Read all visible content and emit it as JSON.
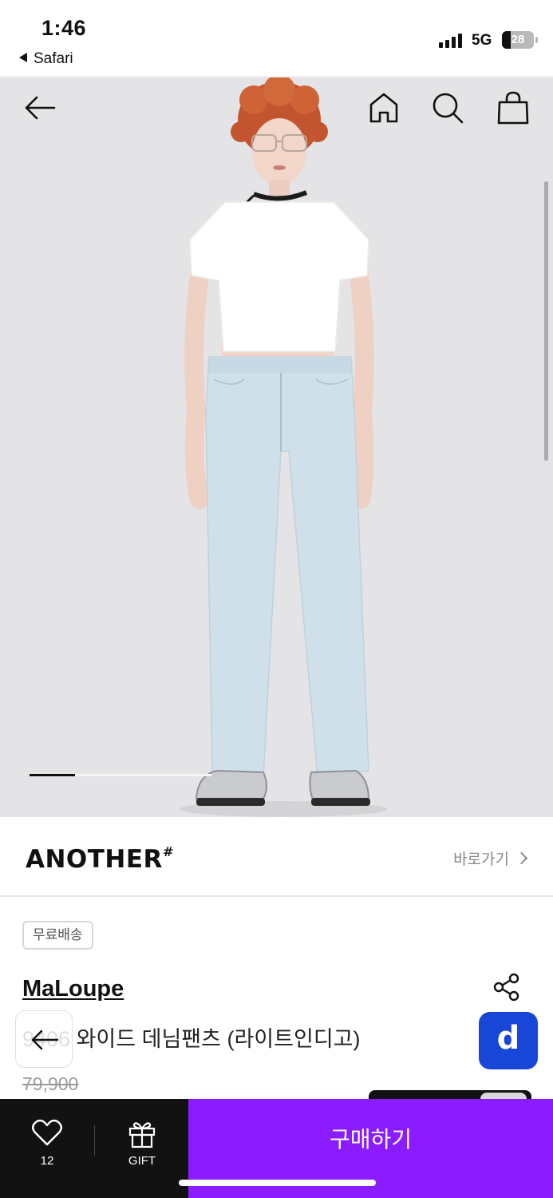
{
  "status_bar": {
    "time": "1:46",
    "back_app": "Safari",
    "network": "5G",
    "battery": "28",
    "battery_level_percent": 28
  },
  "gallery": {
    "current_index_fraction": 0.25,
    "icons": [
      "back-arrow-icon",
      "home-icon",
      "search-icon",
      "shopping-bag-icon"
    ]
  },
  "brand_row": {
    "logo_text": "ANOTHER",
    "logo_mark": "#",
    "link_label": "바로가기"
  },
  "product": {
    "badge": "무료배송",
    "brand": "MaLoupe",
    "name_prefix": "9406",
    "name": "와이드 데님팬츠 (라이트인디고)",
    "original_price": "79,900"
  },
  "floating": {
    "d_button_label": "d"
  },
  "bottom_bar": {
    "like_count": "12",
    "gift_label": "GIFT",
    "buy_label": "구매하기"
  },
  "colors": {
    "buy_button": "#8a1cff",
    "bottom_left": "#121212",
    "d_button": "#1847d8",
    "hero_background": "#e4e4e6"
  }
}
